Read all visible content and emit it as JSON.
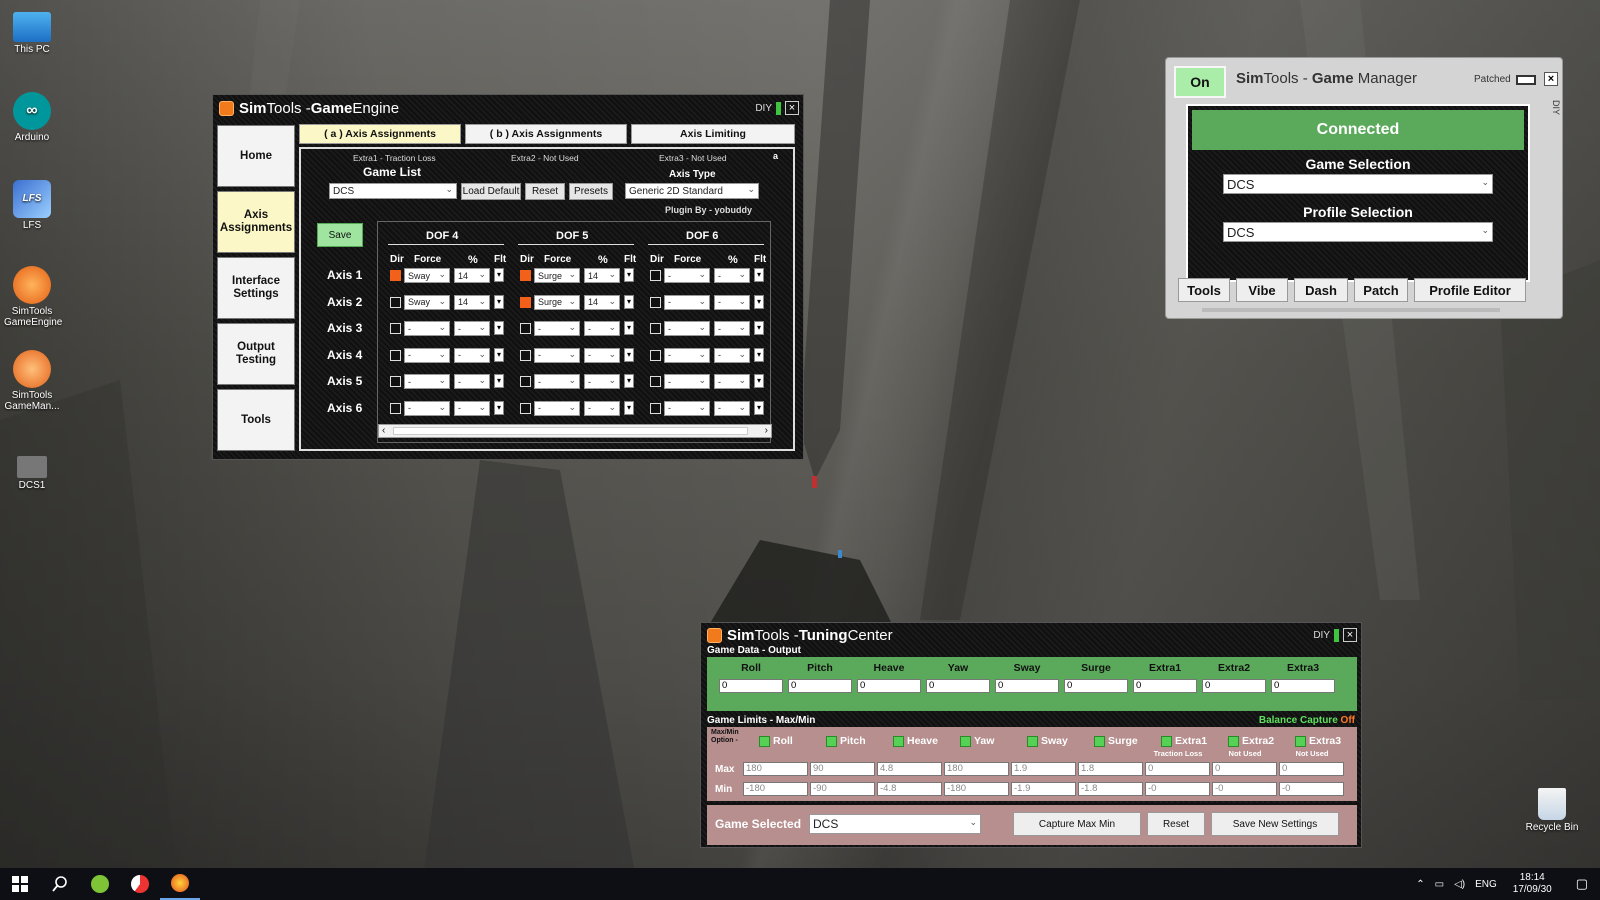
{
  "desktop": {
    "icons": [
      {
        "label": "This PC"
      },
      {
        "label": "Arduino"
      },
      {
        "label": "LFS"
      },
      {
        "label": "SimTools GameEngine"
      },
      {
        "label": "SimTools GameMan..."
      },
      {
        "label": "DCS1"
      }
    ],
    "recycle_bin": "Recycle Bin"
  },
  "game_engine": {
    "title_bold_1": "Sim",
    "title_1": "Tools - ",
    "title_bold_2": "Game",
    "title_2": " Engine",
    "diy": "DIY",
    "close": "×",
    "nav": [
      "Home",
      "Axis Assignments",
      "Interface Settings",
      "Output Testing",
      "Tools"
    ],
    "tabs": [
      "( a ) Axis Assignments",
      "( b ) Axis Assignments",
      "Axis Limiting"
    ],
    "extras": [
      "Extra1 - Traction Loss",
      "Extra2 - Not Used",
      "Extra3 - Not Used"
    ],
    "extras_suffix": "a",
    "game_list_label": "Game List",
    "game_list_value": "DCS",
    "load_default": "Load Default",
    "reset": "Reset",
    "presets": "Presets",
    "axis_type_label": "Axis Type",
    "axis_type_value": "Generic 2D Standard",
    "plugin_by": "Plugin By - yobuddy",
    "save": "Save",
    "dof_headers": [
      "DOF 4",
      "DOF 5",
      "DOF 6"
    ],
    "col_headers": {
      "dir": "Dir",
      "force": "Force",
      "pct": "%",
      "flt": "Flt"
    },
    "axes": [
      {
        "label": "Axis 1",
        "dof": [
          {
            "dir": true,
            "force": "Sway",
            "pct": "14"
          },
          {
            "dir": true,
            "force": "Surge",
            "pct": "14"
          },
          {
            "dir": false,
            "force": "-",
            "pct": "-"
          }
        ]
      },
      {
        "label": "Axis 2",
        "dof": [
          {
            "dir": false,
            "force": "Sway",
            "pct": "14"
          },
          {
            "dir": true,
            "force": "Surge",
            "pct": "14"
          },
          {
            "dir": false,
            "force": "-",
            "pct": "-"
          }
        ]
      },
      {
        "label": "Axis 3",
        "dof": [
          {
            "dir": false,
            "force": "-",
            "pct": "-"
          },
          {
            "dir": false,
            "force": "-",
            "pct": "-"
          },
          {
            "dir": false,
            "force": "-",
            "pct": "-"
          }
        ]
      },
      {
        "label": "Axis 4",
        "dof": [
          {
            "dir": false,
            "force": "-",
            "pct": "-"
          },
          {
            "dir": false,
            "force": "-",
            "pct": "-"
          },
          {
            "dir": false,
            "force": "-",
            "pct": "-"
          }
        ]
      },
      {
        "label": "Axis 5",
        "dof": [
          {
            "dir": false,
            "force": "-",
            "pct": "-"
          },
          {
            "dir": false,
            "force": "-",
            "pct": "-"
          },
          {
            "dir": false,
            "force": "-",
            "pct": "-"
          }
        ]
      },
      {
        "label": "Axis 6",
        "dof": [
          {
            "dir": false,
            "force": "-",
            "pct": "-"
          },
          {
            "dir": false,
            "force": "-",
            "pct": "-"
          },
          {
            "dir": false,
            "force": "-",
            "pct": "-"
          }
        ]
      }
    ]
  },
  "game_manager": {
    "on": "On",
    "title_bold_1": "Sim",
    "title_1": "Tools - ",
    "title_bold_2": "Game",
    "title_2": " Manager",
    "patched": "Patched",
    "diy": "DIY",
    "close": "×",
    "status": "Connected",
    "game_selection_label": "Game Selection",
    "game_selection_value": "DCS",
    "profile_selection_label": "Profile Selection",
    "profile_selection_value": "DCS",
    "buttons": [
      "Tools",
      "Vibe",
      "Dash",
      "Patch",
      "Profile Editor"
    ]
  },
  "tuning_center": {
    "title_bold_1": "Sim",
    "title_1": "Tools - ",
    "title_bold_2": "Tuning",
    "title_2": " Center",
    "diy": "DIY",
    "close": "×",
    "game_data_label": "Game Data - Output",
    "outputs": [
      {
        "name": "Roll",
        "value": "0"
      },
      {
        "name": "Pitch",
        "value": "0"
      },
      {
        "name": "Heave",
        "value": "0"
      },
      {
        "name": "Yaw",
        "value": "0"
      },
      {
        "name": "Sway",
        "value": "0"
      },
      {
        "name": "Surge",
        "value": "0"
      },
      {
        "name": "Extra1",
        "value": "0"
      },
      {
        "name": "Extra2",
        "value": "0"
      },
      {
        "name": "Extra3",
        "value": "0"
      }
    ],
    "limits_label": "Game Limits - Max/Min",
    "balance_capture": "Balance Capture",
    "balance_state": "Off",
    "maxmin_option": "Max/Min Option -",
    "limits": [
      {
        "name": "Roll",
        "sub": "",
        "max": "180",
        "min": "-180"
      },
      {
        "name": "Pitch",
        "sub": "",
        "max": "90",
        "min": "-90"
      },
      {
        "name": "Heave",
        "sub": "",
        "max": "4.8",
        "min": "-4.8"
      },
      {
        "name": "Yaw",
        "sub": "",
        "max": "180",
        "min": "-180"
      },
      {
        "name": "Sway",
        "sub": "",
        "max": "1.9",
        "min": "-1.9"
      },
      {
        "name": "Surge",
        "sub": "",
        "max": "1.8",
        "min": "-1.8"
      },
      {
        "name": "Extra1",
        "sub": "Traction Loss",
        "max": "0",
        "min": "-0"
      },
      {
        "name": "Extra2",
        "sub": "Not Used",
        "max": "0",
        "min": "-0"
      },
      {
        "name": "Extra3",
        "sub": "Not Used",
        "max": "0",
        "min": "-0"
      }
    ],
    "max_label": "Max",
    "min_label": "Min",
    "game_selected_label": "Game Selected",
    "game_selected_value": "DCS",
    "capture_max_min": "Capture Max Min",
    "reset": "Reset",
    "save_new_settings": "Save New Settings"
  },
  "taskbar": {
    "lang": "ENG",
    "time": "18:14",
    "date": "17/09/30"
  }
}
